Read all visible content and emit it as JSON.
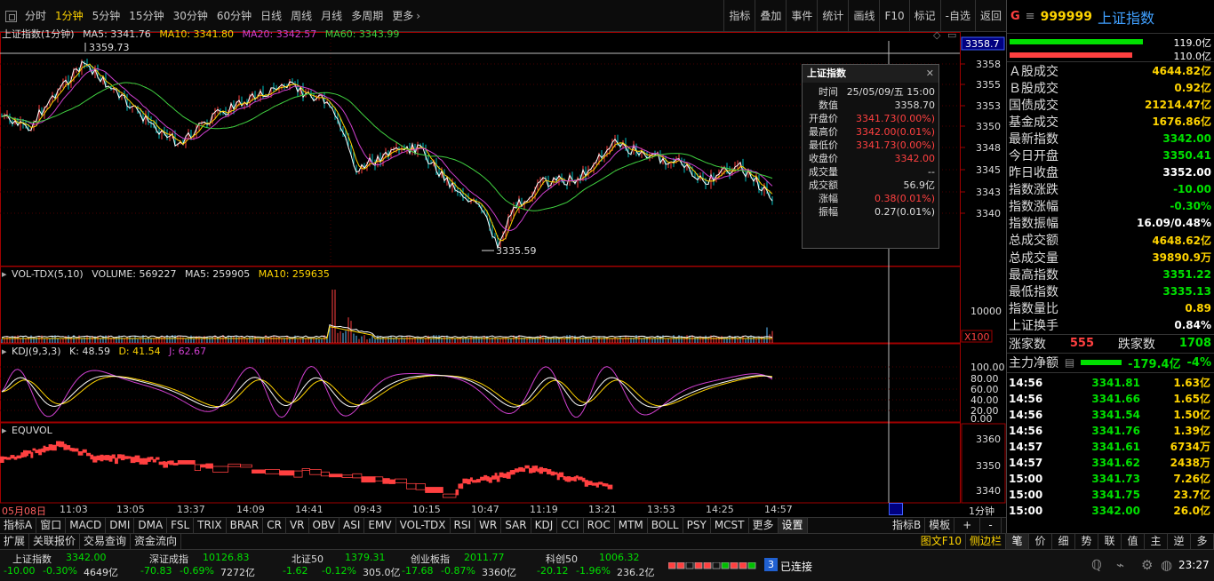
{
  "periods": [
    "分时",
    "1分钟",
    "5分钟",
    "15分钟",
    "30分钟",
    "60分钟",
    "日线",
    "周线",
    "月线",
    "多周期",
    "更多"
  ],
  "active_period": "1分钟",
  "tools": [
    "指标",
    "叠加",
    "事件",
    "统计",
    "画线",
    "F10",
    "标记",
    "-自选",
    "返回"
  ],
  "main_legend": {
    "title": "上证指数(1分钟)",
    "ma5": "MA5: 3341.76",
    "ma10": "MA10: 3341.80",
    "ma20": "MA20: 3342.57",
    "ma60": "MA60: 3343.99"
  },
  "vol_legend": {
    "title": "VOL-TDX(5,10)",
    "volume": "VOLUME: 569227",
    "ma5": "MA5: 259905",
    "ma10": "MA10: 259635"
  },
  "kdj_legend": {
    "title": "KDJ(9,3,3)",
    "k": "K: 48.59",
    "d": "D: 41.54",
    "j": "J: 62.67"
  },
  "equ_legend": {
    "title": "EQUVOL"
  },
  "annotations": {
    "high": "3359.73",
    "low": "3335.59",
    "cursor_price": "3358.7",
    "vol_unit": "X100"
  },
  "price_axis": [
    "3358",
    "3355",
    "3353",
    "3350",
    "3348",
    "3345",
    "3343",
    "3340"
  ],
  "vol_axis": [
    "10000"
  ],
  "kdj_axis": [
    "100.00",
    "80.00",
    "60.00",
    "40.00",
    "20.00",
    "0.00"
  ],
  "equ_axis": [
    "3360",
    "3350",
    "3340"
  ],
  "time_axis": [
    "05月08日",
    "11:03",
    "13:05",
    "13:37",
    "14:09",
    "14:41",
    "09:43",
    "10:15",
    "10:47",
    "11:19",
    "13:21",
    "13:53",
    "14:25",
    "14:57"
  ],
  "period_label": "1分钟",
  "tooltip": {
    "title": "上证指数",
    "close_icon": "✕",
    "rows": [
      {
        "k": "时间",
        "v": "25/05/09/五 15:00",
        "c": "#dddddd"
      },
      {
        "k": "数值",
        "v": "3358.70",
        "c": "#dddddd"
      },
      {
        "k": "开盘价",
        "v": "3341.73(0.00%)",
        "c": "#ff4040"
      },
      {
        "k": "最高价",
        "v": "3342.00(0.01%)",
        "c": "#ff4040"
      },
      {
        "k": "最低价",
        "v": "3341.73(0.00%)",
        "c": "#ff4040"
      },
      {
        "k": "收盘价",
        "v": "3342.00",
        "c": "#ff4040"
      },
      {
        "k": "成交量",
        "v": "--",
        "c": "#dddddd"
      },
      {
        "k": "成交额",
        "v": "56.9亿",
        "c": "#dddddd"
      },
      {
        "k": "涨幅",
        "v": "0.38(0.01%)",
        "c": "#ff4040"
      },
      {
        "k": "振幅",
        "v": "0.27(0.01%)",
        "c": "#dddddd"
      }
    ]
  },
  "indicator_tabs": [
    "指标A",
    "窗口",
    "MACD",
    "DMI",
    "DMA",
    "FSL",
    "TRIX",
    "BRAR",
    "CR",
    "VR",
    "OBV",
    "ASI",
    "EMV",
    "VOL-TDX",
    "RSI",
    "WR",
    "SAR",
    "KDJ",
    "CCI",
    "ROC",
    "MTM",
    "BOLL",
    "PSY",
    "MCST",
    "更多",
    "设置"
  ],
  "indicator_tabs_right": [
    "指标B",
    "模板",
    "+",
    "-"
  ],
  "lower_tabs": [
    "扩展",
    "关联报价",
    "交易查询",
    "资金流向"
  ],
  "lower_right": [
    "图文F10",
    "侧边栏"
  ],
  "quote": {
    "g": "G",
    "menu": "≡",
    "code": "999999",
    "name": "上证指数"
  },
  "bars": [
    {
      "value": "119.0亿",
      "color": "#00e000"
    },
    {
      "value": "110.0亿",
      "color": "#ff4040"
    }
  ],
  "stats": [
    {
      "label": "Ａ股成交",
      "value": "4644.82亿",
      "color": "#ffd400"
    },
    {
      "label": "Ｂ股成交",
      "value": "0.92亿",
      "color": "#ffd400"
    },
    {
      "label": "国债成交",
      "value": "21214.47亿",
      "color": "#ffd400"
    },
    {
      "label": "基金成交",
      "value": "1676.86亿",
      "color": "#ffd400"
    },
    {
      "label": "最新指数",
      "value": "3342.00",
      "color": "#00e000"
    },
    {
      "label": "今日开盘",
      "value": "3350.41",
      "color": "#00e000"
    },
    {
      "label": "昨日收盘",
      "value": "3352.00",
      "color": "#ffffff"
    },
    {
      "label": "指数涨跌",
      "value": "-10.00",
      "color": "#00e000"
    },
    {
      "label": "指数涨幅",
      "value": "-0.30%",
      "color": "#00e000"
    },
    {
      "label": "指数振幅",
      "value": "16.09/0.48%",
      "color": "#ffffff"
    },
    {
      "label": "总成交额",
      "value": "4648.62亿",
      "color": "#ffd400"
    },
    {
      "label": "总成交量",
      "value": "39890.9万",
      "color": "#ffd400"
    },
    {
      "label": "最高指数",
      "value": "3351.22",
      "color": "#00e000"
    },
    {
      "label": "最低指数",
      "value": "3335.13",
      "color": "#00e000"
    },
    {
      "label": "指数量比",
      "value": "0.89",
      "color": "#ffd400"
    },
    {
      "label": "上证换手",
      "value": "0.84%",
      "color": "#ffffff"
    }
  ],
  "breadth": {
    "up_label": "涨家数",
    "up": "555",
    "down_label": "跌家数",
    "down": "1708"
  },
  "mainflow": {
    "label": "主力净额",
    "value": "-179.4亿",
    "pct": "-4%"
  },
  "ticks": [
    {
      "t": "14:56",
      "p": "3341.81",
      "v": "1.63亿"
    },
    {
      "t": "14:56",
      "p": "3341.66",
      "v": "1.65亿"
    },
    {
      "t": "14:56",
      "p": "3341.54",
      "v": "1.50亿"
    },
    {
      "t": "14:56",
      "p": "3341.76",
      "v": "1.39亿"
    },
    {
      "t": "14:57",
      "p": "3341.61",
      "v": "6734万"
    },
    {
      "t": "14:57",
      "p": "3341.62",
      "v": "2438万"
    },
    {
      "t": "15:00",
      "p": "3341.73",
      "v": "7.26亿"
    },
    {
      "t": "15:00",
      "p": "3341.75",
      "v": "23.7亿"
    },
    {
      "t": "15:00",
      "p": "3342.00",
      "v": "26.0亿"
    }
  ],
  "right_tabs": [
    "笔",
    "价",
    "细",
    "势",
    "联",
    "值",
    "主",
    "逆",
    "多"
  ],
  "indices": [
    {
      "name": "上证指数",
      "value": "3342.00",
      "chg": "-10.00",
      "pct": "-0.30%",
      "amt": "4649亿"
    },
    {
      "name": "深证成指",
      "value": "10126.83",
      "chg": "-70.83",
      "pct": "-0.69%",
      "amt": "7272亿"
    },
    {
      "name": "北证50",
      "value": "1379.31",
      "chg": "-1.62",
      "pct": "-0.12%",
      "amt": "305.0亿"
    },
    {
      "name": "创业板指",
      "value": "2011.77",
      "chg": "-17.68",
      "pct": "-0.87%",
      "amt": "3360亿"
    },
    {
      "name": "科创50",
      "value": "1006.32",
      "chg": "-20.12",
      "pct": "-1.96%",
      "amt": "236.2亿"
    }
  ],
  "connection": {
    "count": "3",
    "label": "已连接"
  },
  "clock": "23:27"
}
